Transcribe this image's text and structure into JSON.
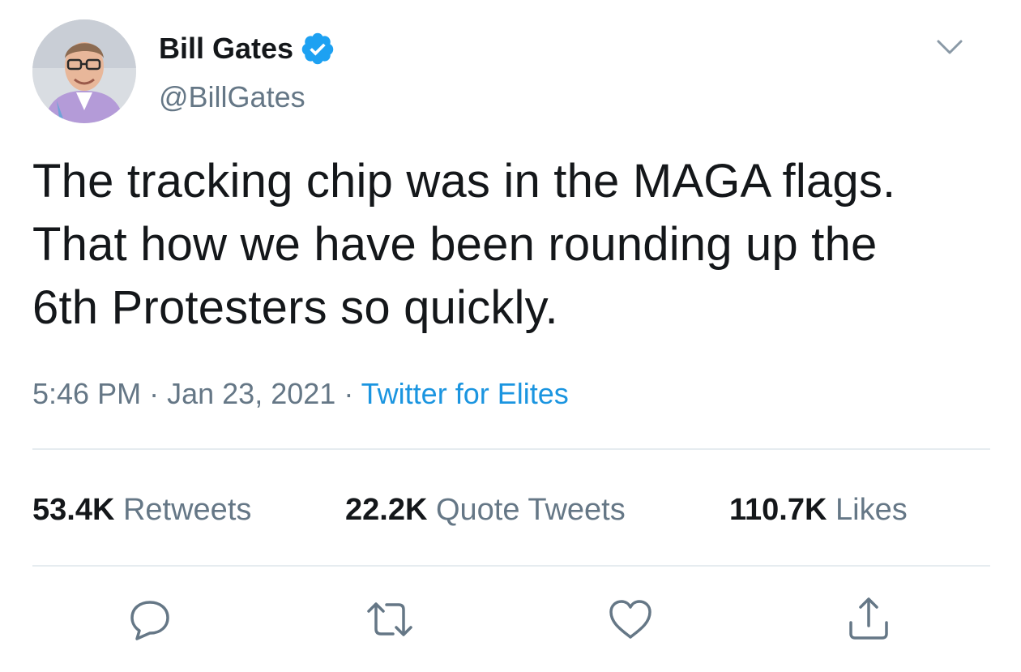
{
  "user": {
    "display_name": "Bill Gates",
    "handle": "@BillGates",
    "verified_icon": "verified-badge-icon",
    "avatar_icon": "profile-photo"
  },
  "tweet": {
    "lines": [
      "The tracking chip was in the MAGA flags.",
      "That how we have been rounding up the",
      "6th Protesters so quickly."
    ],
    "time": "5:46 PM",
    "separator": "·",
    "date": "Jan 23, 2021",
    "source": "Twitter for Elites"
  },
  "stats": {
    "retweets": {
      "count": "53.4K",
      "label": "Retweets"
    },
    "quotes": {
      "count": "22.2K",
      "label": "Quote Tweets"
    },
    "likes": {
      "count": "110.7K",
      "label": "Likes"
    }
  },
  "actions": [
    "reply-icon",
    "retweet-icon",
    "like-icon",
    "share-icon"
  ],
  "colors": {
    "text": "#14171a",
    "secondary": "#657786",
    "accent": "#1b95e0",
    "divider": "#e6ecf0"
  }
}
